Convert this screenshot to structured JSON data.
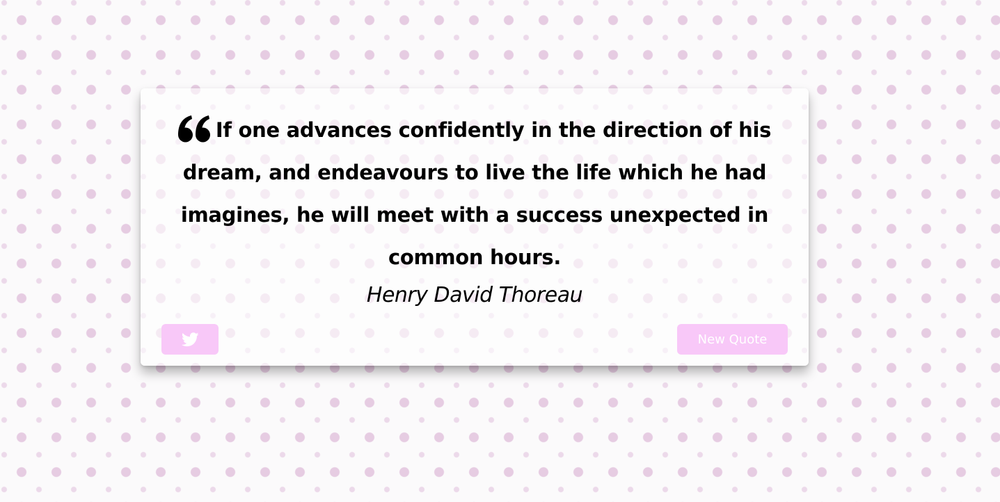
{
  "quote": {
    "text": "If one advances confidently in the direction of his dream, and endeavours to live the life which he had imagines, he will meet with a success unexpected in common hours.",
    "author": "Henry David Thoreau"
  },
  "buttons": {
    "tweet_icon": "twitter-icon",
    "new_quote_label": "New Quote"
  },
  "colors": {
    "button_bg": "#f8c8f8",
    "button_text": "#ffffff",
    "text": "#000000",
    "dot_pattern": "#e6cce2"
  }
}
